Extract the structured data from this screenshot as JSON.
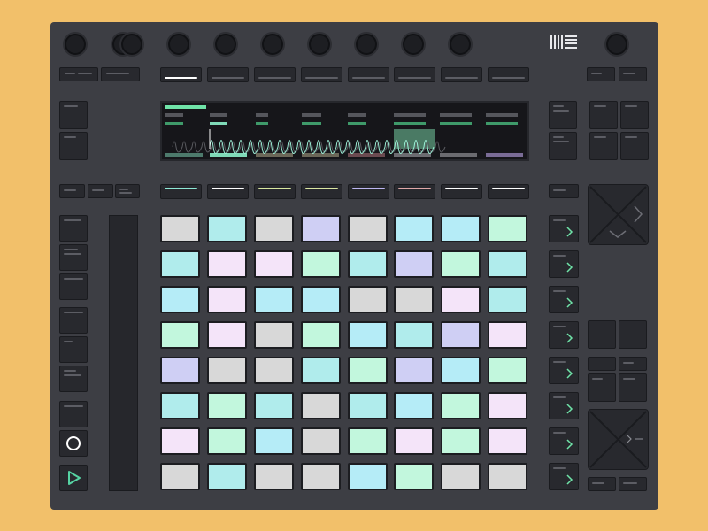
{
  "brand": {
    "logo_icon": "ableton-logo-icon"
  },
  "colors": {
    "background": "#f2c06a",
    "device": "#3d3e44",
    "button": "#28292e",
    "accent_green": "#6fe3a8",
    "play_green": "#56d3a3",
    "display_bg": "#16161a"
  },
  "knobs": {
    "encoder_count": 9,
    "top_left_count": 2,
    "master_count": 1
  },
  "track_select_colors": [
    "#8ee9d6",
    "#ffffff",
    "#d9e8a0",
    "#dbe7a2",
    "#bdb7f2",
    "#e0a8a8",
    "#ffffff",
    "#ffffff"
  ],
  "display": {
    "track_colors": [
      "#4d7a6c",
      "#7fdab8",
      "#6b6758",
      "#6b6758",
      "#6b4a50",
      "#6b6b70",
      "#6b6b70",
      "#7a6c96"
    ],
    "highlight_column": 5
  },
  "pad_grid": {
    "rows": 8,
    "cols": 8,
    "colors": [
      [
        "#d8d8d8",
        "#b0ecec",
        "#d8d8d8",
        "#cfcff4",
        "#d8d8d8",
        "#b5ecf7",
        "#b5ecf7",
        "#c2f7dd"
      ],
      [
        "#b0ecec",
        "#f4e4f9",
        "#f4e4f9",
        "#c2f7dd",
        "#b0ecec",
        "#cfcff4",
        "#c2f7dd",
        "#b0ecec"
      ],
      [
        "#b5ecf7",
        "#f4e4f9",
        "#b5ecf7",
        "#b5ecf7",
        "#d8d8d8",
        "#d8d8d8",
        "#f4e4f9",
        "#b0ecec"
      ],
      [
        "#c2f7dd",
        "#f4e4f9",
        "#d8d8d8",
        "#c2f7dd",
        "#b5ecf7",
        "#b0ecec",
        "#cfcff4",
        "#f4e4f9"
      ],
      [
        "#cfcff4",
        "#d8d8d8",
        "#d8d8d8",
        "#b0ecec",
        "#c2f7dd",
        "#cfcff4",
        "#b5ecf7",
        "#c2f7dd"
      ],
      [
        "#b0ecec",
        "#c2f7dd",
        "#b0ecec",
        "#d8d8d8",
        "#b0ecec",
        "#b5ecf7",
        "#c2f7dd",
        "#f4e4f9"
      ],
      [
        "#f4e4f9",
        "#c2f7dd",
        "#b5ecf7",
        "#d8d8d8",
        "#c2f7dd",
        "#f4e4f9",
        "#c2f7dd",
        "#f4e4f9"
      ],
      [
        "#d8d8d8",
        "#b0ecec",
        "#d8d8d8",
        "#d8d8d8",
        "#b5ecf7",
        "#c2f7dd",
        "#d8d8d8",
        "#d8d8d8"
      ]
    ]
  },
  "transport": {
    "record_icon": "record-circle-icon",
    "play_icon": "play-triangle-icon"
  },
  "scene_launch": {
    "count": 8,
    "icon": "chevron-right-icon"
  },
  "nav": {
    "dpad_icon": "dpad-cross-icon"
  }
}
